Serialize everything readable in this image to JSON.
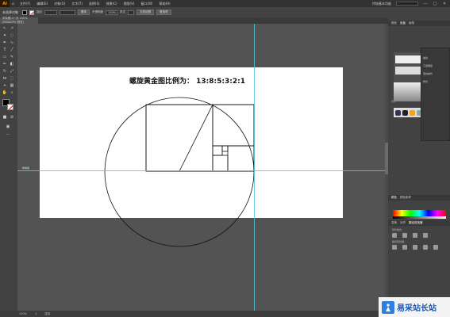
{
  "app": {
    "logo": "Ai",
    "home_icon": "home-icon"
  },
  "menu": {
    "items": [
      "文件(F)",
      "编辑(E)",
      "对象(O)",
      "文字(T)",
      "选择(S)",
      "效果(C)",
      "视图(V)",
      "窗口(W)",
      "帮助(H)"
    ],
    "workspace": "传统基本功能",
    "window_buttons": [
      "—",
      "□",
      "✕"
    ]
  },
  "control": {
    "selection": "未选择对象",
    "stroke_label": "描边",
    "basic_label": "基本",
    "opacity_label": "不透明度",
    "opacity_value": "100%",
    "style_label": "样式",
    "doc_setup": "文档设置",
    "prefs": "首选项"
  },
  "document": {
    "tab_title": "未标题-1* @ 100% (RGB/GPU 预览)"
  },
  "artboard": {
    "title": "螺旋黄金图比例为：   13:8:5:3:2:1"
  },
  "guides": {
    "label": "参考线"
  },
  "status": {
    "zoom": "100%",
    "tool": "选择",
    "artboard_nav": "1"
  },
  "panels": {
    "top_tabs": [
      "颜色",
      "色板",
      "画笔"
    ],
    "layers_rows": [
      "描边",
      "不透明度",
      "混合模式",
      "样式"
    ],
    "symbols_label": "符号",
    "color_tabs": [
      "颜色",
      "颜色参考"
    ],
    "pathfinder_tabs": [
      "变换",
      "对齐",
      "路径查找器"
    ],
    "shape_modes": "形状模式：",
    "pathfinders": "路径查找器："
  },
  "colors": {
    "accent": "#ff9a00",
    "guide": "#4ec8d8",
    "panel": "#424242",
    "canvas": "#535353"
  },
  "watermark": {
    "text": "易采站长站"
  }
}
